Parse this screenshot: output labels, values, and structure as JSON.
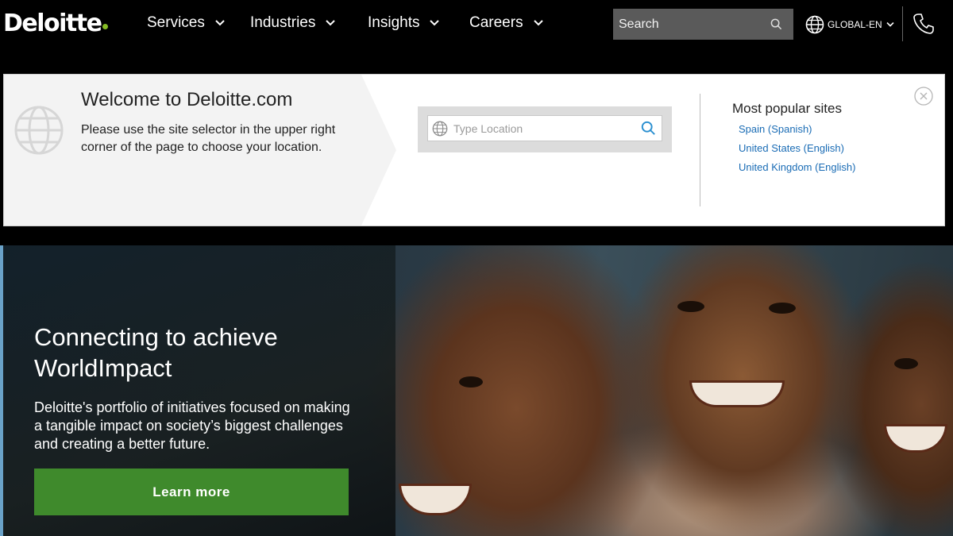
{
  "brand": {
    "name": "Deloitte",
    "dot_color": "#86bc25"
  },
  "nav": {
    "items": [
      {
        "label": "Services"
      },
      {
        "label": "Industries"
      },
      {
        "label": "Insights"
      },
      {
        "label": "Careers"
      }
    ],
    "search_placeholder": "Search",
    "language_label": "GLOBAL-EN"
  },
  "welcome": {
    "title": "Welcome to Deloitte.com",
    "text": "Please use the site selector in the upper right corner of the page to choose your location.",
    "location_placeholder": "Type Location",
    "popular_title": "Most popular sites",
    "popular_sites": [
      {
        "label": "Spain (Spanish)"
      },
      {
        "label": "United States (English)"
      },
      {
        "label": "United Kingdom (English)"
      }
    ]
  },
  "hero": {
    "title": "Connecting to achieve WorldImpact",
    "text": "Deloitte's portfolio of initiatives focused on making a tangible impact on society’s biggest challenges and creating a better future.",
    "button_label": "Learn more",
    "button_color": "#3f8a2c"
  },
  "colors": {
    "link": "#1a6cb5",
    "background": "#000000"
  },
  "icons": [
    "chevron-down-icon",
    "search-icon",
    "globe-icon",
    "phone-icon",
    "close-icon"
  ]
}
